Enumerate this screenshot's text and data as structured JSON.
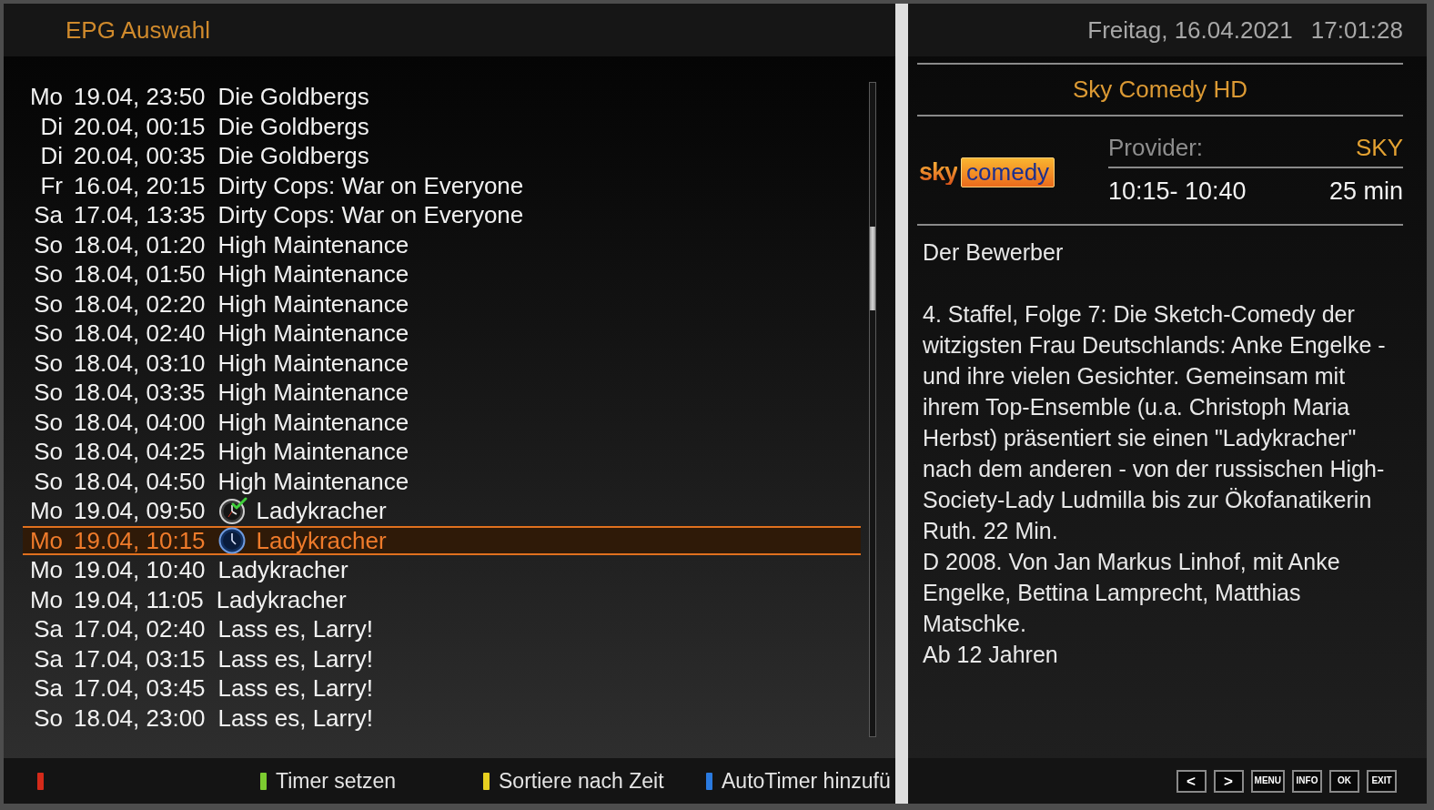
{
  "header": {
    "title": "EPG Auswahl"
  },
  "events": [
    {
      "kind": "plain",
      "day": "Mo",
      "datetime": "19.04, 23:50",
      "title": "Die Goldbergs",
      "selected": false
    },
    {
      "kind": "plain",
      "day": "Di",
      "datetime": "20.04, 00:15",
      "title": "Die Goldbergs",
      "selected": false
    },
    {
      "kind": "plain",
      "day": "Di",
      "datetime": "20.04, 00:35",
      "title": "Die Goldbergs",
      "selected": false
    },
    {
      "kind": "plain",
      "day": "Fr",
      "datetime": "16.04, 20:15",
      "title": "Dirty Cops: War on Everyone",
      "selected": false
    },
    {
      "kind": "plain",
      "day": "Sa",
      "datetime": "17.04, 13:35",
      "title": "Dirty Cops: War on Everyone",
      "selected": false
    },
    {
      "kind": "plain",
      "day": "So",
      "datetime": "18.04, 01:20",
      "title": "High Maintenance",
      "selected": false
    },
    {
      "kind": "plain",
      "day": "So",
      "datetime": "18.04, 01:50",
      "title": "High Maintenance",
      "selected": false
    },
    {
      "kind": "plain",
      "day": "So",
      "datetime": "18.04, 02:20",
      "title": "High Maintenance",
      "selected": false
    },
    {
      "kind": "plain",
      "day": "So",
      "datetime": "18.04, 02:40",
      "title": "High Maintenance",
      "selected": false
    },
    {
      "kind": "plain",
      "day": "So",
      "datetime": "18.04, 03:10",
      "title": "High Maintenance",
      "selected": false
    },
    {
      "kind": "plain",
      "day": "So",
      "datetime": "18.04, 03:35",
      "title": "High Maintenance",
      "selected": false
    },
    {
      "kind": "plain",
      "day": "So",
      "datetime": "18.04, 04:00",
      "title": "High Maintenance",
      "selected": false
    },
    {
      "kind": "plain",
      "day": "So",
      "datetime": "18.04, 04:25",
      "title": "High Maintenance",
      "selected": false
    },
    {
      "kind": "plain",
      "day": "So",
      "datetime": "18.04, 04:50",
      "title": "High Maintenance",
      "selected": false
    },
    {
      "kind": "timer",
      "day": "Mo",
      "datetime": "19.04, 09:50",
      "title": "Ladykracher",
      "selected": false
    },
    {
      "kind": "reminder",
      "day": "Mo",
      "datetime": "19.04, 10:15",
      "title": "Ladykracher",
      "selected": true
    },
    {
      "kind": "plain",
      "day": "Mo",
      "datetime": "19.04, 10:40",
      "title": "Ladykracher",
      "selected": false
    },
    {
      "kind": "plain",
      "day": "Mo",
      "datetime": "19.04, 11:05",
      "title": "Ladykracher",
      "selected": false
    },
    {
      "kind": "plain",
      "day": "Sa",
      "datetime": "17.04, 02:40",
      "title": "Lass es, Larry!",
      "selected": false
    },
    {
      "kind": "plain",
      "day": "Sa",
      "datetime": "17.04, 03:15",
      "title": "Lass es, Larry!",
      "selected": false
    },
    {
      "kind": "plain",
      "day": "Sa",
      "datetime": "17.04, 03:45",
      "title": "Lass es, Larry!",
      "selected": false
    },
    {
      "kind": "plain",
      "day": "So",
      "datetime": "18.04, 23:00",
      "title": "Lass es, Larry!",
      "selected": false
    }
  ],
  "color_buttons": [
    {
      "color": "#d42a1a"
    },
    {
      "color": "#7ccc30",
      "label": "Timer setzen"
    },
    {
      "color": "#e8d020",
      "label": "Sortiere nach Zeit"
    },
    {
      "color": "#2a7ae0",
      "label": "AutoTimer hinzufü"
    }
  ],
  "clock": {
    "date": "Freitag, 16.04.2021",
    "time": "17:01:28"
  },
  "channel": {
    "name": "Sky Comedy HD",
    "logo": {
      "brand": "sky",
      "name": "comedy"
    },
    "provider_label": "Provider:",
    "provider": "SKY",
    "time_range": "10:15- 10:40",
    "duration": "25 min"
  },
  "description": {
    "title": "Der Bewerber",
    "paragraphs": [
      "4. Staffel, Folge 7: Die Sketch-Comedy der witzigsten Frau Deutschlands: Anke Engelke - und ihre vielen Gesichter. Gemeinsam mit ihrem Top-Ensemble (u.a. Christoph Maria Herbst) präsentiert sie einen \"Ladykracher\" nach dem anderen - von der russischen High-Society-Lady Ludmilla bis zur Ökofanatikerin Ruth. 22 Min.",
      "D 2008. Von Jan Markus Linhof, mit Anke Engelke, Bettina Lamprecht, Matthias Matschke.",
      "Ab 12 Jahren"
    ]
  },
  "nav_keys": [
    {
      "label": "<",
      "kind": "arrow"
    },
    {
      "label": ">",
      "kind": "arrow"
    },
    {
      "label": "MENU",
      "kind": "word"
    },
    {
      "label": "INFO",
      "kind": "word"
    },
    {
      "label": "OK",
      "kind": "word"
    },
    {
      "label": "EXIT",
      "kind": "word"
    }
  ]
}
